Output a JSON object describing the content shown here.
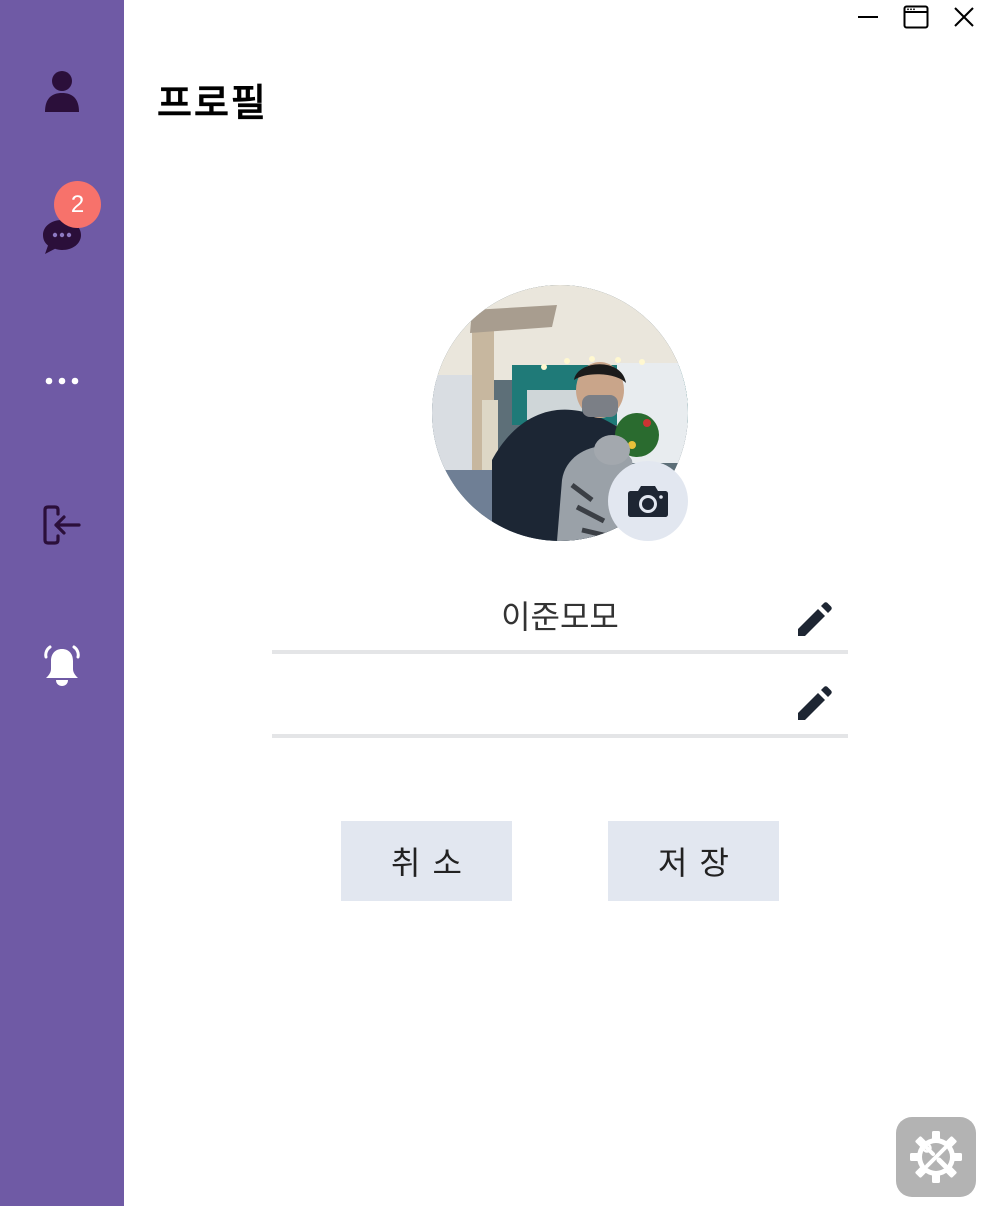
{
  "window": {
    "minimize_icon": "minimize-icon",
    "maximize_icon": "window-icon",
    "close_icon": "close-icon"
  },
  "sidebar": {
    "color": "#6f5aa5",
    "items": [
      {
        "id": "profile",
        "icon": "user-icon"
      },
      {
        "id": "chat",
        "icon": "chat-bubble-icon",
        "badge": "2"
      },
      {
        "id": "more",
        "icon": "more-dots-icon"
      },
      {
        "id": "logout",
        "icon": "logout-icon"
      },
      {
        "id": "notifications",
        "icon": "bell-icon"
      }
    ]
  },
  "page": {
    "title": "프로필"
  },
  "profile": {
    "avatar_icon": "avatar-photo",
    "camera_icon": "camera-icon",
    "name": "이준모모",
    "status_message": "",
    "edit_icon": "pencil-icon"
  },
  "actions": {
    "cancel_label": "취소",
    "save_label": "저장",
    "button_color": "#e2e7f0"
  },
  "settings": {
    "icon": "settings-tools-icon"
  },
  "colors": {
    "badge": "#f7726b",
    "icon_dark": "#2b0f3a",
    "divider": "#e4e5e7"
  }
}
